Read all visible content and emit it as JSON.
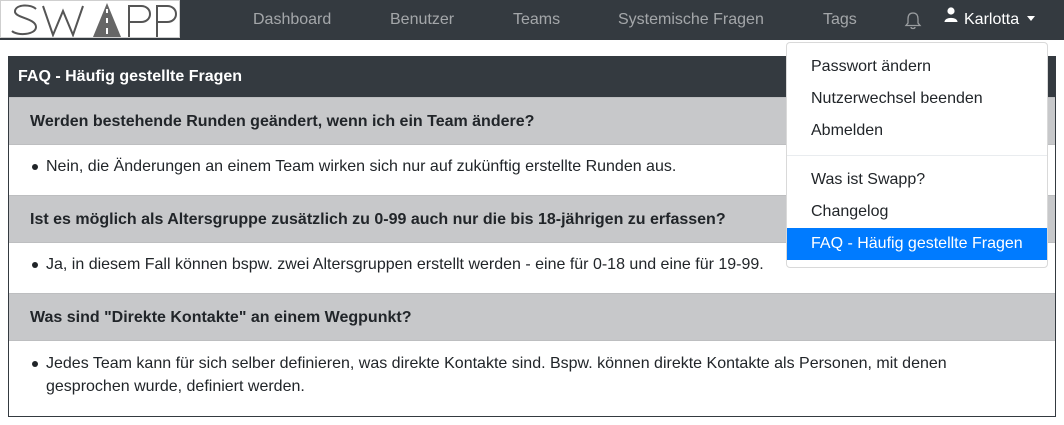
{
  "navbar": {
    "logo_text": "SWAPP",
    "items": [
      {
        "label": "Dashboard"
      },
      {
        "label": "Benutzer"
      },
      {
        "label": "Teams"
      },
      {
        "label": "Systemische Fragen"
      },
      {
        "label": "Tags"
      }
    ],
    "user": {
      "name": "Karlotta"
    }
  },
  "dropdown": {
    "items": [
      {
        "label": "Passwort ändern"
      },
      {
        "label": "Nutzerwechsel beenden"
      },
      {
        "label": "Abmelden"
      },
      {
        "label": "Was ist Swapp?"
      },
      {
        "label": "Changelog"
      },
      {
        "label": "FAQ - Häufig gestellte Fragen",
        "active": true
      }
    ]
  },
  "faq": {
    "title": "FAQ - Häufig gestellte Fragen",
    "entries": [
      {
        "question": "Werden bestehende Runden geändert, wenn ich ein Team ändere?",
        "answer": "Nein, die Änderungen an einem Team wirken sich nur auf zukünftig erstellte Runden aus."
      },
      {
        "question": "Ist es möglich als Altersgruppe zusätzlich zu 0-99 auch nur die bis 18-jährigen zu erfassen?",
        "answer": "Ja, in diesem Fall können bspw. zwei Altersgruppen erstellt werden - eine für 0-18 und eine für 19-99."
      },
      {
        "question": "Was sind \"Direkte Kontakte\" an einem Wegpunkt?",
        "answer": "Jedes Team kann für sich selber definieren, was direkte Kontakte sind. Bspw. können direkte Kontakte als Personen, mit denen gesprochen wurde, definiert werden."
      }
    ]
  },
  "colors": {
    "navbar_bg": "#343a40",
    "question_bg": "#c7c8ca",
    "active_item": "#007bff"
  },
  "icons": [
    "bell-icon",
    "user-icon",
    "caret-down-icon"
  ]
}
